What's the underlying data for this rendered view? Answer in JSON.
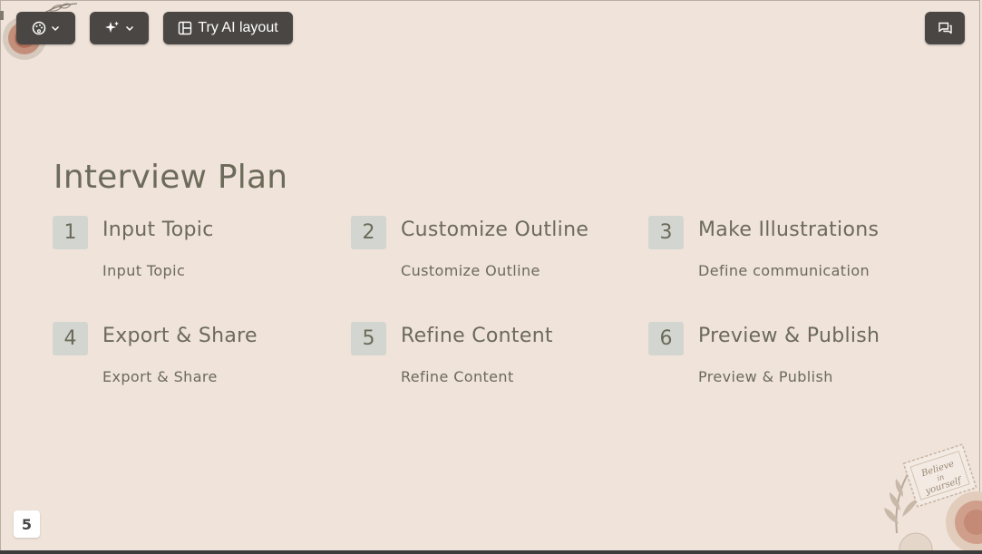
{
  "toolbar": {
    "theme_icon": "palette-icon",
    "ai_icon": "sparkle-icon",
    "layout_icon": "layout-icon",
    "layout_label": "Try AI layout",
    "comment_icon": "comment-icon"
  },
  "slide": {
    "title": "Interview Plan",
    "steps": [
      {
        "number": "1",
        "title": "Input Topic",
        "description": "Input Topic"
      },
      {
        "number": "2",
        "title": "Customize Outline",
        "description": "Customize Outline"
      },
      {
        "number": "3",
        "title": "Make Illustrations",
        "description": "Define communication"
      },
      {
        "number": "4",
        "title": "Export & Share",
        "description": "Export & Share"
      },
      {
        "number": "5",
        "title": "Refine Content",
        "description": "Refine Content"
      },
      {
        "number": "6",
        "title": "Preview & Publish",
        "description": "Preview & Publish"
      }
    ],
    "page_number": "5"
  },
  "colors": {
    "background": "#efe3da",
    "text": "#6c6a59",
    "number_box": "#d3d6d0",
    "toolbar": "#4a4643"
  }
}
